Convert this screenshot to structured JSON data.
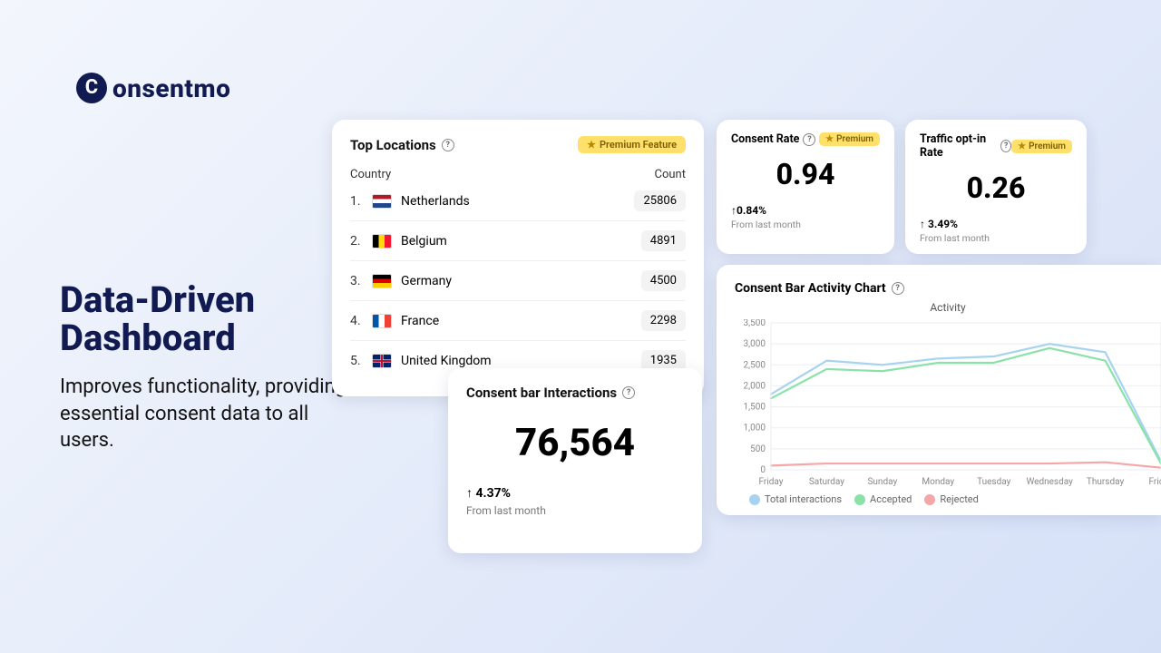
{
  "brand": {
    "name": "onsentmo",
    "mark": "C"
  },
  "hero": {
    "title": "Data-Driven Dashboard",
    "subtitle": "Improves functionality, providing essential consent data to all users."
  },
  "topLocations": {
    "title": "Top Locations",
    "badge": "Premium Feature",
    "headerCountry": "Country",
    "headerCount": "Count",
    "rows": [
      {
        "rank": "1.",
        "country": "Netherlands",
        "count": "25806",
        "flag": "nl"
      },
      {
        "rank": "2.",
        "country": "Belgium",
        "count": "4891",
        "flag": "be"
      },
      {
        "rank": "3.",
        "country": "Germany",
        "count": "4500",
        "flag": "de"
      },
      {
        "rank": "4.",
        "country": "France",
        "count": "2298",
        "flag": "fr"
      },
      {
        "rank": "5.",
        "country": "United Kingdom",
        "count": "1935",
        "flag": "gb"
      }
    ]
  },
  "interactions": {
    "title": "Consent bar Interactions",
    "value": "76,564",
    "delta": "4.37%",
    "sub": "From last month"
  },
  "consentRate": {
    "title": "Consent Rate",
    "badge": "Premium",
    "value": "0.94",
    "delta": "0.84%",
    "sub": "From last month"
  },
  "trafficRate": {
    "title": "Traffic opt-in Rate",
    "badge": "Premium",
    "value": "0.26",
    "delta": "3.49%",
    "sub": "From last month"
  },
  "chart": {
    "title": "Consent Bar Activity Chart",
    "subtitle": "Activity",
    "legend": {
      "total": "Total interactions",
      "accepted": "Accepted",
      "rejected": "Rejected"
    },
    "colors": {
      "total": "#a6d3ef",
      "accepted": "#8ae2a8",
      "rejected": "#f5a6a6",
      "grid": "#eceef2",
      "axis": "#b0b5bf"
    }
  },
  "chart_data": {
    "type": "line",
    "title": "Activity",
    "xlabel": "",
    "ylabel": "",
    "ylim": [
      0,
      3500
    ],
    "yticks": [
      0,
      500,
      1000,
      1500,
      2000,
      2500,
      3000,
      3500
    ],
    "categories": [
      "Friday",
      "Saturday",
      "Sunday",
      "Monday",
      "Tuesday",
      "Wednesday",
      "Thursday",
      "Friday"
    ],
    "series": [
      {
        "name": "Total interactions",
        "values": [
          1800,
          2600,
          2500,
          2650,
          2700,
          3000,
          2800,
          200
        ]
      },
      {
        "name": "Accepted",
        "values": [
          1700,
          2400,
          2350,
          2550,
          2550,
          2900,
          2600,
          150
        ]
      },
      {
        "name": "Rejected",
        "values": [
          100,
          150,
          150,
          150,
          150,
          150,
          180,
          50
        ]
      }
    ]
  }
}
